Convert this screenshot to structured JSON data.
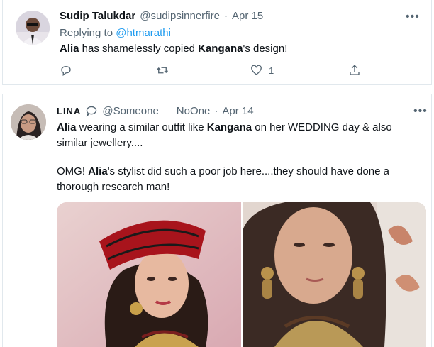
{
  "tweet1": {
    "display_name": "Sudip Talukdar",
    "handle": "@sudipsinnerfire",
    "separator": "·",
    "date": "Apr 15",
    "replying_prefix": "Replying to",
    "replying_handle": "@htmarathi",
    "text_parts": [
      "Alia",
      " has shamelessly copied ",
      "Kangana",
      "'s design!"
    ],
    "like_count": "1",
    "more_label": "•••"
  },
  "tweet2": {
    "display_name": "LINA",
    "handle": "@Someone___NoOne",
    "separator": "·",
    "date": "Apr 14",
    "para1_parts": [
      "Alia",
      " wearing a similar outfit like ",
      "Kangana",
      " on her WEDDING day & also"
    ],
    "para1_line2": "similar jewellery....",
    "para2_parts": [
      "OMG! ",
      "Alia",
      "'s stylist did such a poor job here....they should have done a"
    ],
    "para2_line2": "thorough research man!",
    "more_label": "•••"
  },
  "icons": {
    "reply": "reply-icon",
    "retweet": "retweet-icon",
    "like": "heart-icon",
    "share": "share-icon",
    "verified_badge": "speech-bubble-icon"
  },
  "colors": {
    "link": "#1d9bf0",
    "muted": "#536471",
    "text": "#0f1419",
    "border": "#e1e8ed"
  }
}
